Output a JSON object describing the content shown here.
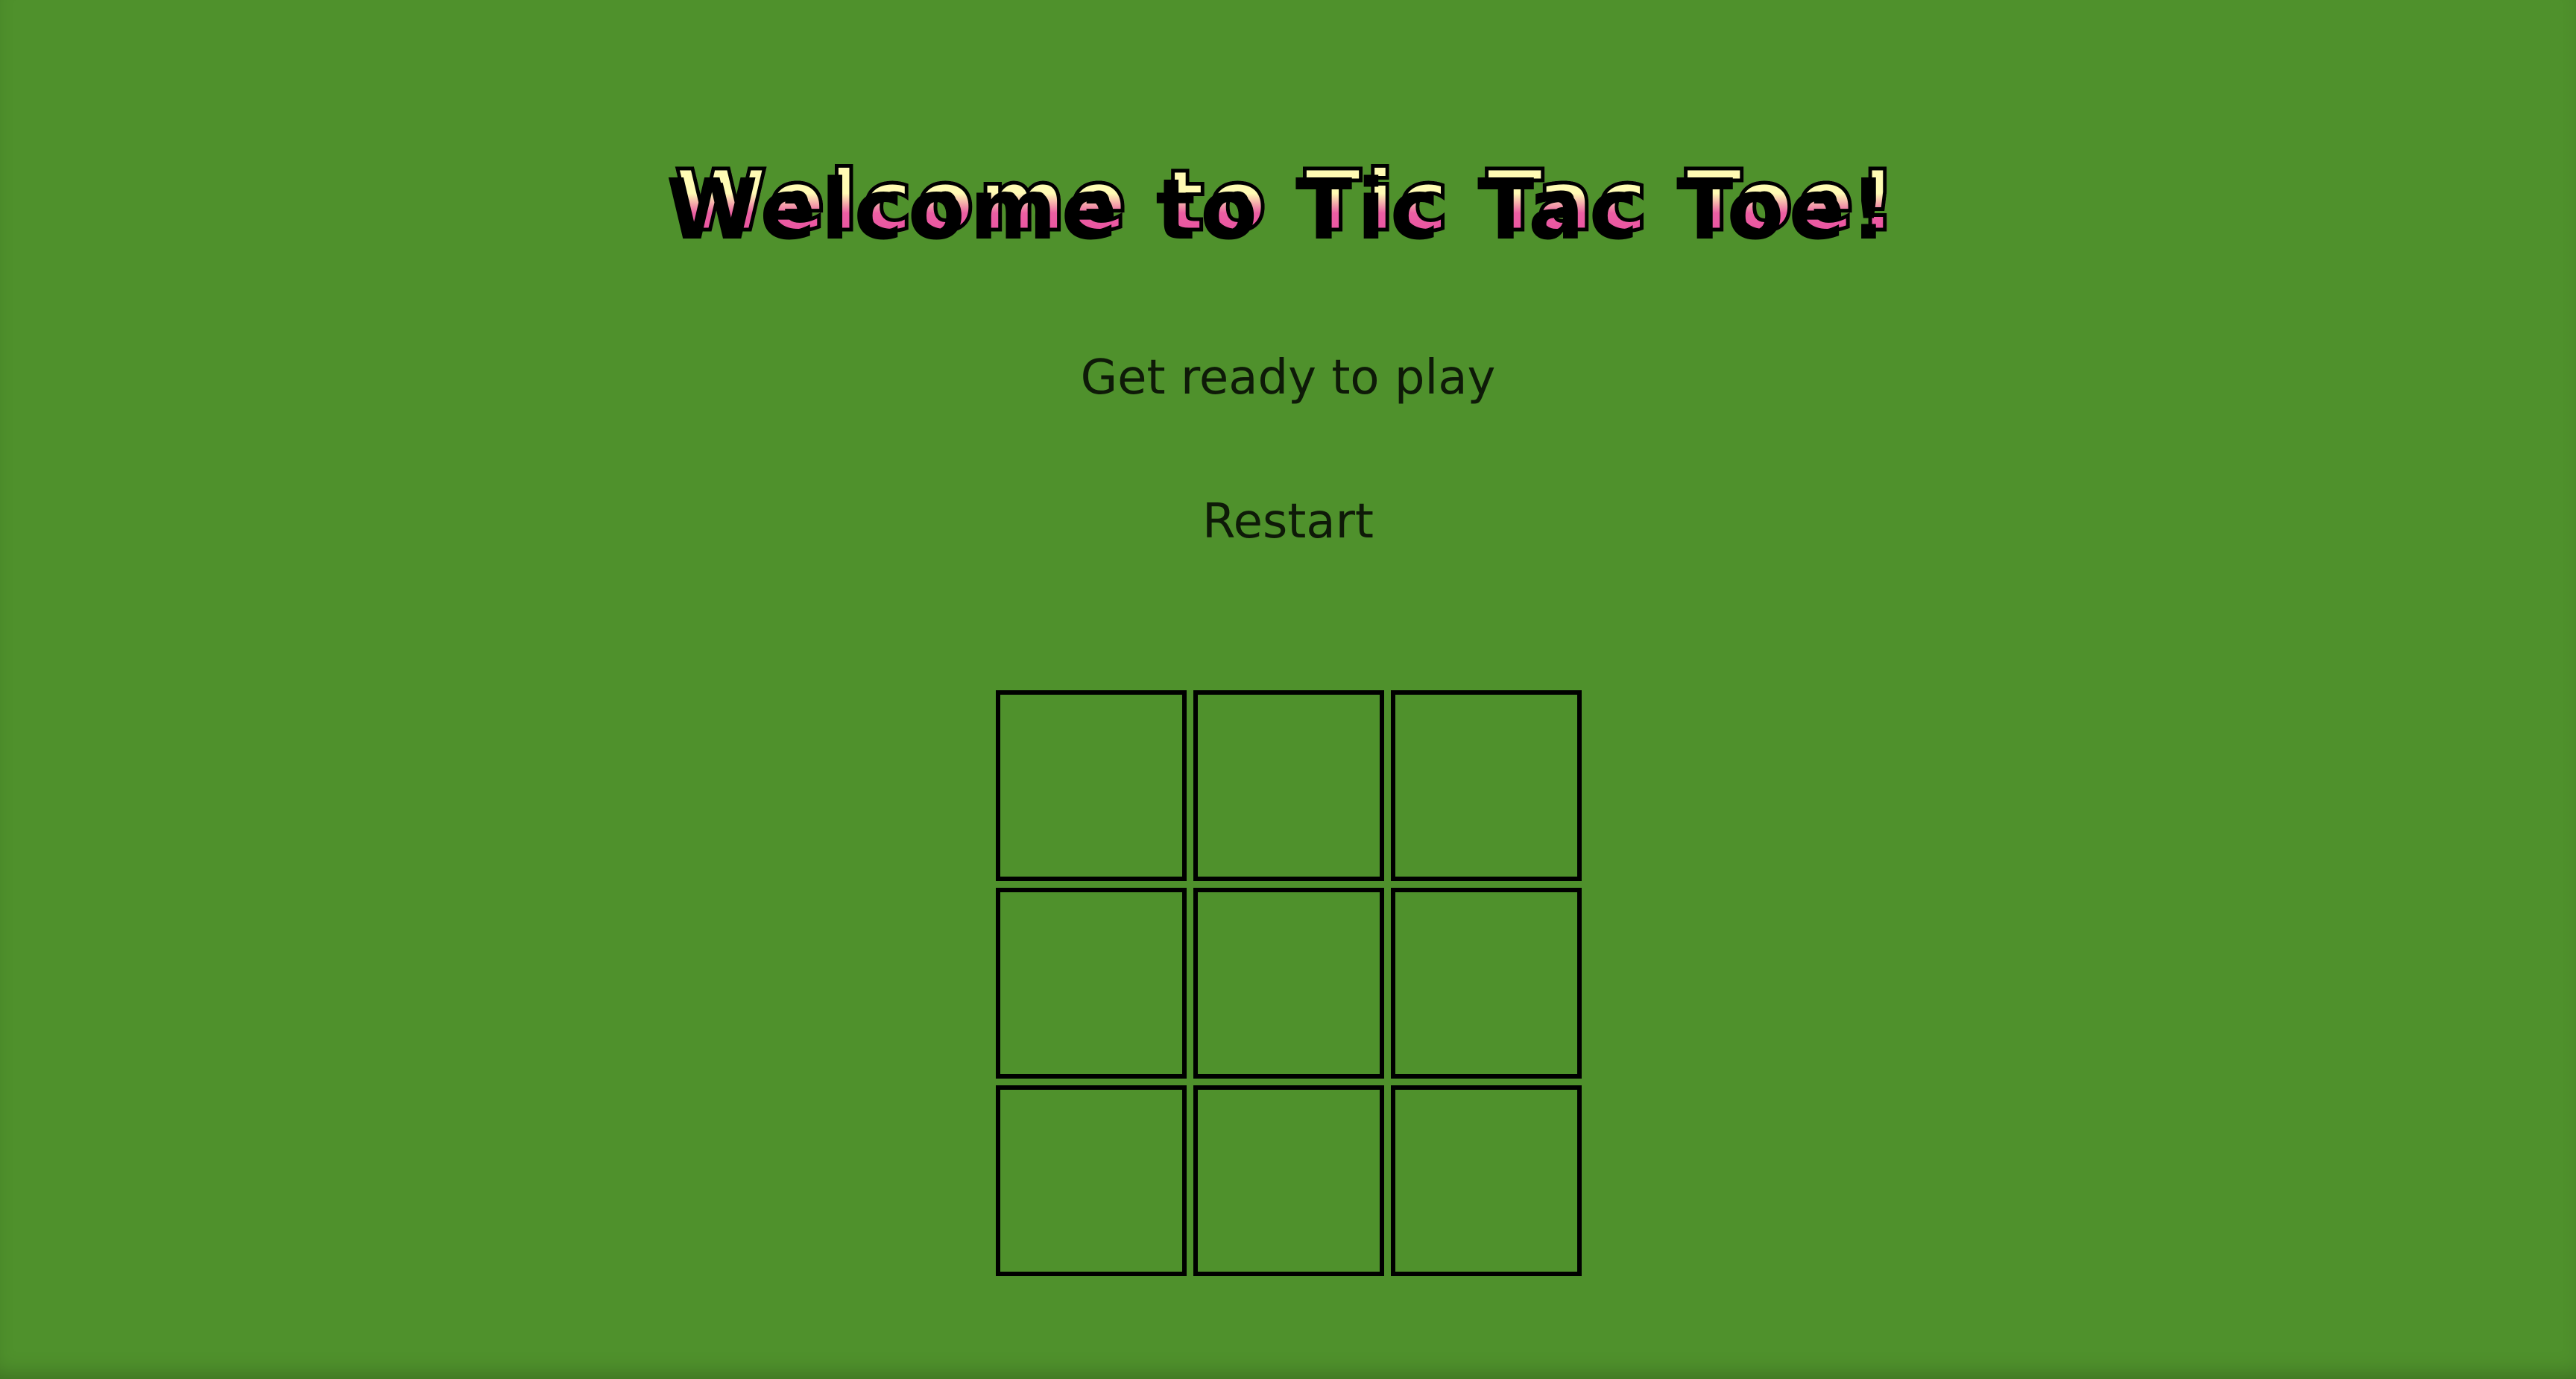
{
  "header": {
    "title": "Welcome to Tic Tac Toe!"
  },
  "status": {
    "message": "Get ready to play"
  },
  "controls": {
    "restart_label": "Restart"
  },
  "board": {
    "cells": [
      "",
      "",
      "",
      "",
      "",
      "",
      "",
      "",
      ""
    ]
  },
  "colors": {
    "background": "#4f912c",
    "title_top": "#fffbb4",
    "title_bottom": "#e84aa0",
    "grid_line": "#000000"
  }
}
